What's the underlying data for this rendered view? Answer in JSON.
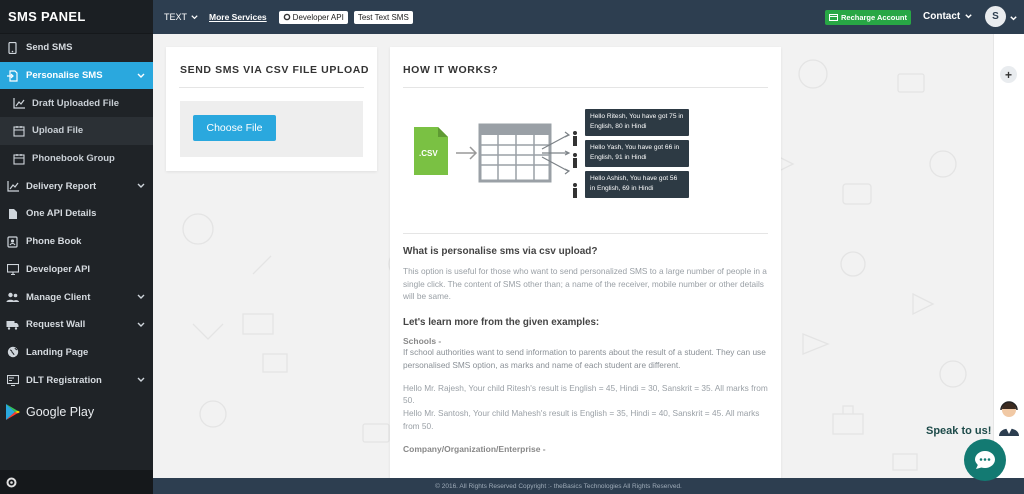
{
  "brand": {
    "title": "SMS PANEL"
  },
  "sidebar": {
    "items": [
      {
        "label": "Send SMS",
        "icon": "mobile-icon",
        "has_chevron": false
      },
      {
        "label": "Personalise SMS",
        "icon": "file-import-icon",
        "has_chevron": true,
        "active": true
      },
      {
        "label": "Draft Uploaded File",
        "icon": "chart-line-icon",
        "sub": true
      },
      {
        "label": "Upload File",
        "icon": "calendar-icon",
        "sub": true,
        "selected": true
      },
      {
        "label": "Phonebook Group",
        "icon": "calendar-icon",
        "sub": true
      },
      {
        "label": "Delivery Report",
        "icon": "chart-line-icon",
        "has_chevron": true
      },
      {
        "label": "One API Details",
        "icon": "file-icon"
      },
      {
        "label": "Phone Book",
        "icon": "contact-book-icon"
      },
      {
        "label": "Developer API",
        "icon": "monitor-icon"
      },
      {
        "label": "Manage Client",
        "icon": "users-icon",
        "has_chevron": true
      },
      {
        "label": "Request Wall",
        "icon": "truck-icon",
        "has_chevron": true
      },
      {
        "label": "Landing Page",
        "icon": "globe-icon"
      },
      {
        "label": "DLT Registration",
        "icon": "register-icon",
        "has_chevron": true
      }
    ],
    "google_play": "Google Play"
  },
  "topbar": {
    "text_dropdown": "TEXT",
    "more_services": "More Services",
    "developer_api": "Developer API",
    "test_text_sms": "Test Text SMS",
    "recharge": "Recharge Account",
    "contact": "Contact",
    "avatar_initial": "S"
  },
  "upload_card": {
    "title": "SEND SMS VIA CSV FILE UPLOAD",
    "button": "Choose File"
  },
  "how_card": {
    "title": "HOW IT WORKS?",
    "diagram": {
      "csv_label": ".CSV",
      "messages": [
        "Hello Ritesh, You have got 75 in English, 80 in Hindi",
        "Hello Yash, You have got 66 in English, 91 in Hindi",
        "Hello Ashish, You have got 56 in English, 69 in Hindi"
      ]
    },
    "question": "What is personalise sms via csv upload?",
    "answer": "This option is useful for those who want to send personalized SMS to a large number of people in a single click. The content of SMS other than; a name of the receiver, mobile number or other details will be same.",
    "examples_heading": "Let's learn more from the given examples:",
    "schools_label": "Schools -",
    "schools_text": "If school authorities want to send information to parents about the result of a student. They can use personalised SMS option, as marks and name of each student are different.",
    "example_1": "Hello Mr. Rajesh, Your child Ritesh's result is English = 45, Hindi = 30, Sanskrit = 35. All marks from 50.",
    "example_2": "Hello Mr. Santosh, Your child Mahesh's result is English = 35, Hindi = 40, Sanskrit = 45. All marks from 50.",
    "company_label": "Company/Organization/Enterprise -"
  },
  "footer": {
    "text": "© 2016. All Rights Reserved Copyright :- theBasics Technologies All Rights Reserved."
  },
  "chat": {
    "speak": "Speak to us!"
  },
  "colors": {
    "sidebar": "#1f2327",
    "topbar": "#2d3e50",
    "accent": "#2aa8de",
    "recharge": "#28a745",
    "chat": "#137a72"
  }
}
